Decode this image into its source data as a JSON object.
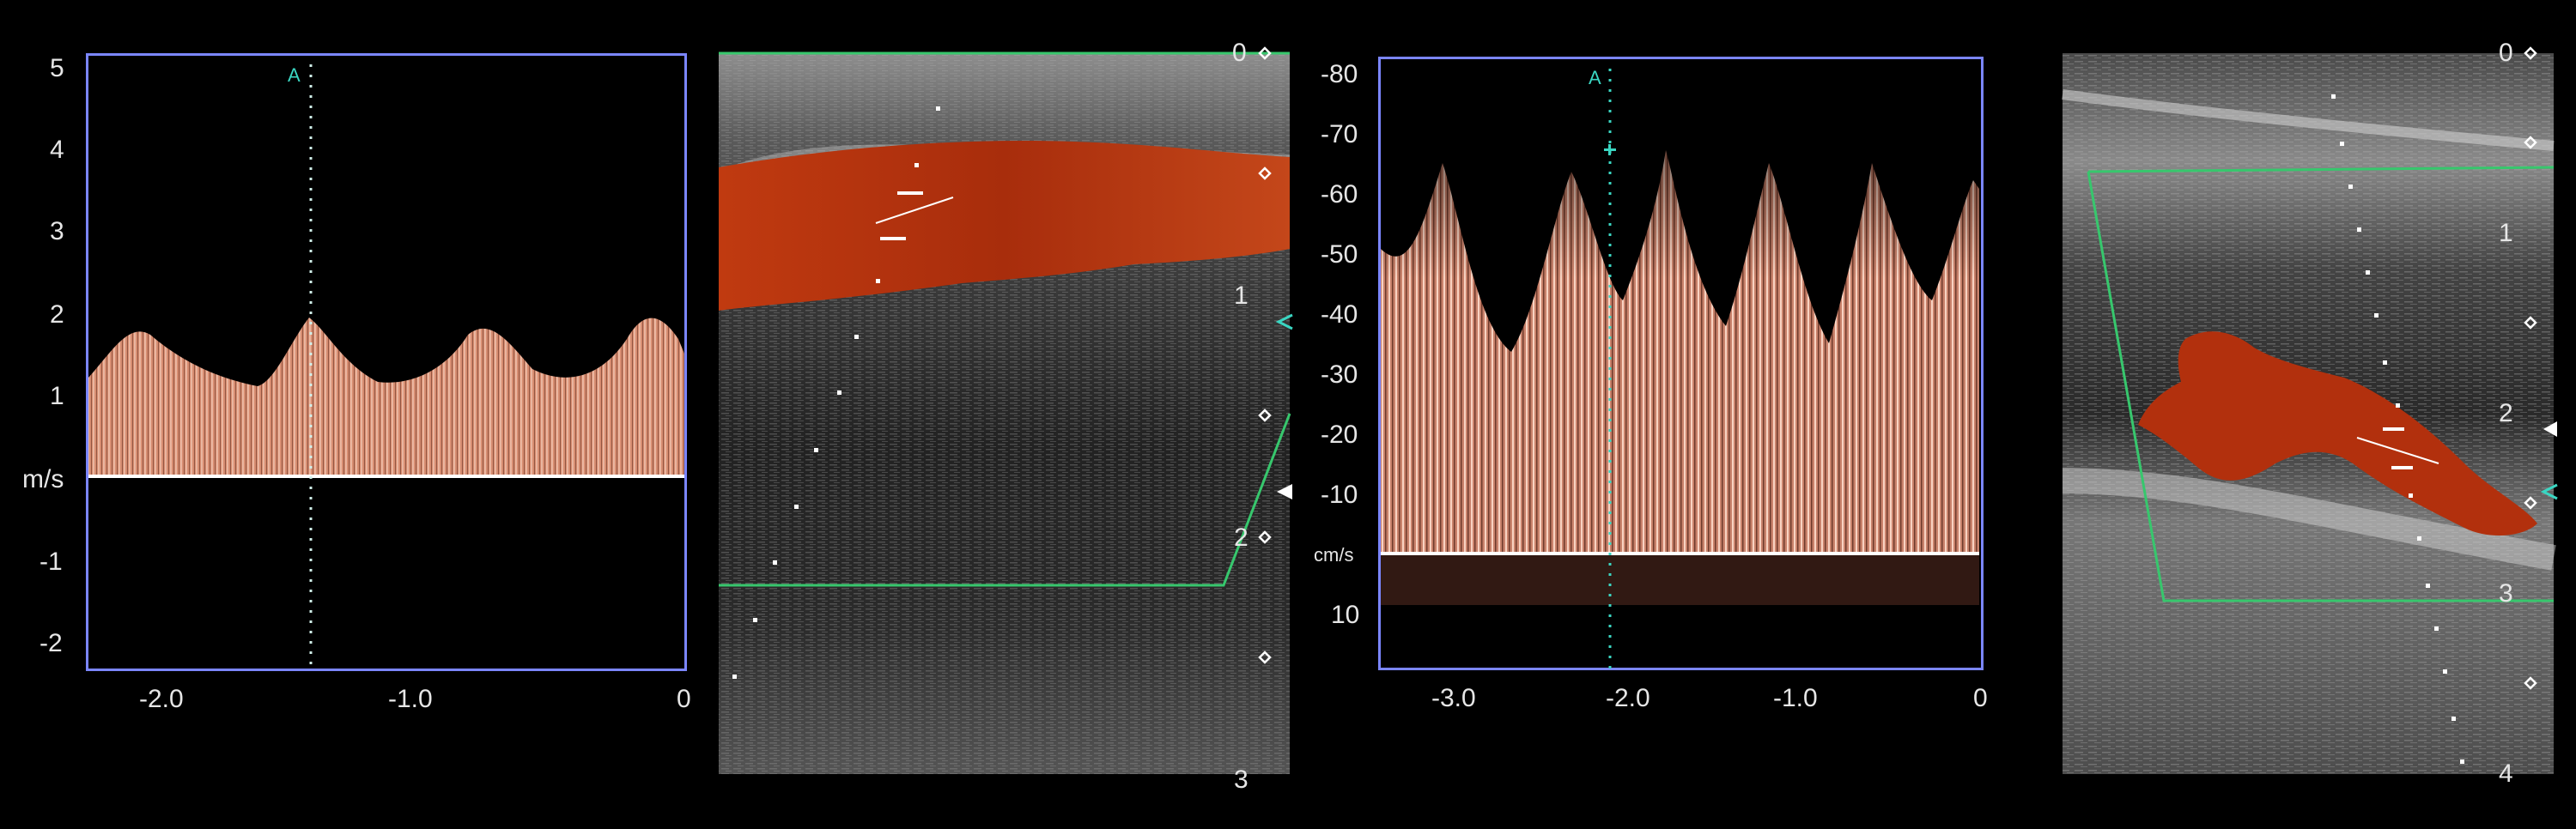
{
  "panels": [
    {
      "type": "spectral_doppler",
      "marker": "A",
      "unit": "m/s",
      "y_ticks": [
        "5",
        "4",
        "3",
        "2",
        "1",
        "-1",
        "-2"
      ],
      "x_ticks": [
        "-2.0",
        "-1.0",
        "0"
      ]
    },
    {
      "type": "color_doppler_image",
      "depth_ticks": [
        "0",
        "1",
        "2",
        "3"
      ]
    },
    {
      "type": "spectral_doppler",
      "marker": "A",
      "unit": "cm/s",
      "y_ticks": [
        "-80",
        "-70",
        "-60",
        "-50",
        "-40",
        "-30",
        "-20",
        "-10",
        "10"
      ],
      "x_ticks": [
        "-3.0",
        "-2.0",
        "-1.0",
        "0"
      ]
    },
    {
      "type": "color_doppler_image",
      "depth_ticks": [
        "0",
        "1",
        "2",
        "3",
        "4"
      ]
    }
  ],
  "colors": {
    "frame": "#7b86ff",
    "spectrum": "#f0a387",
    "flow": "#b2300d",
    "sample_line": "#3ad6c2",
    "roi_box": "#37c76d"
  }
}
